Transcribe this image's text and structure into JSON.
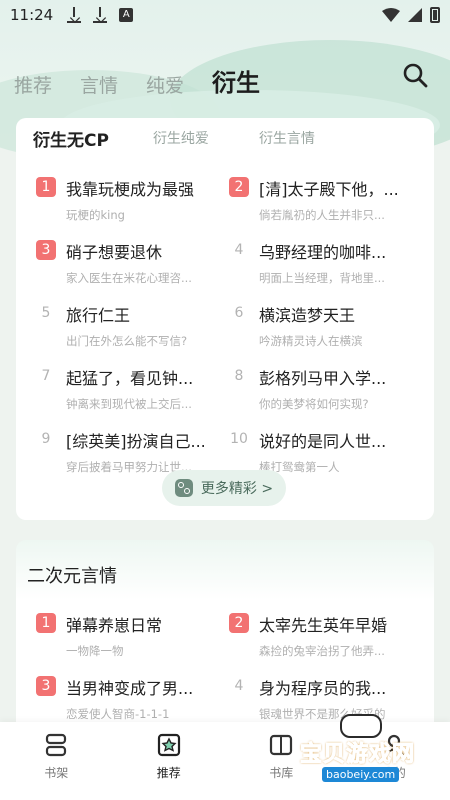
{
  "status_bar": {
    "time": "11:24",
    "notification_icons": [
      "download-icon",
      "download-icon",
      "a-icon"
    ],
    "a_icon_label": "A"
  },
  "top_tabs": [
    {
      "label": "推荐",
      "active": false
    },
    {
      "label": "言情",
      "active": false
    },
    {
      "label": "纯爱",
      "active": false
    },
    {
      "label": "衍生",
      "active": true
    }
  ],
  "section1": {
    "sub_tabs": [
      {
        "label": "衍生无CP",
        "active": true
      },
      {
        "label": "衍生纯爱",
        "active": false
      },
      {
        "label": "衍生言情",
        "active": false
      }
    ],
    "books": [
      {
        "rank": "1",
        "title": "我靠玩梗成为最强",
        "desc": "玩梗的king"
      },
      {
        "rank": "2",
        "title": "[清]太子殿下他，...",
        "desc": "倘若胤礽的人生并非只..."
      },
      {
        "rank": "3",
        "title": "硝子想要退休",
        "desc": "家入医生在米花心理咨..."
      },
      {
        "rank": "4",
        "title": "乌野经理的咖啡...",
        "desc": "明面上当经理，背地里..."
      },
      {
        "rank": "5",
        "title": "旅行仁王",
        "desc": "出门在外怎么能不写信?"
      },
      {
        "rank": "6",
        "title": "横滨造梦天王",
        "desc": "吟游精灵诗人在横滨"
      },
      {
        "rank": "7",
        "title": "起猛了，看见钟...",
        "desc": "钟离来到现代被上交后..."
      },
      {
        "rank": "8",
        "title": "彭格列马甲入学...",
        "desc": "你的美梦将如何实现?"
      },
      {
        "rank": "9",
        "title": "[综英美]扮演自己...",
        "desc": "穿后披着马甲努力让世..."
      },
      {
        "rank": "10",
        "title": "说好的是同人世...",
        "desc": "棒打鸳鸯第一人"
      }
    ],
    "more_label": "更多精彩 >"
  },
  "section2": {
    "title": "二次元言情",
    "books": [
      {
        "rank": "1",
        "title": "弹幕养崽日常",
        "desc": "一物降一物"
      },
      {
        "rank": "2",
        "title": "太宰先生英年早婚",
        "desc": "森捡的兔宰治拐了他弄..."
      },
      {
        "rank": "3",
        "title": "当男神变成了男...",
        "desc": "恋爱使人智商-1-1-1"
      },
      {
        "rank": "4",
        "title": "身为程序员的我...",
        "desc": "银魂世界不是那么好采的"
      }
    ]
  },
  "bottom_nav": [
    {
      "label": "书架",
      "icon": "bookshelf-icon",
      "active": false
    },
    {
      "label": "推荐",
      "icon": "recommend-icon",
      "active": true
    },
    {
      "label": "书库",
      "icon": "library-icon",
      "active": false
    },
    {
      "label": "我的",
      "icon": "profile-icon",
      "active": false
    }
  ],
  "watermark": {
    "text": "宝贝游戏网",
    "url": "baobeiy.com"
  },
  "colors": {
    "accent": "#a9dcc6",
    "rank_top": "#f27272",
    "background": "#eef3ef"
  }
}
